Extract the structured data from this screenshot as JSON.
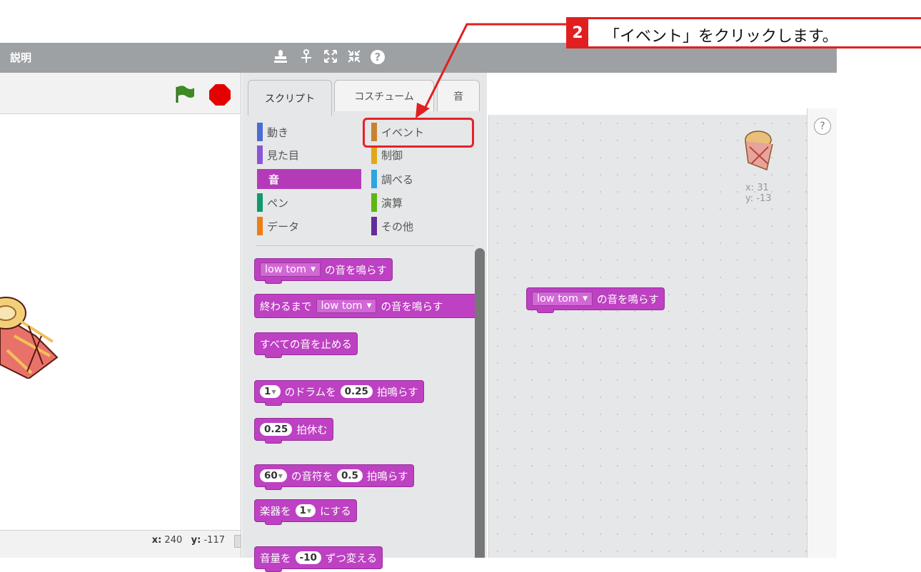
{
  "header": {
    "title": "説明",
    "tool_icons": [
      "stamp-icon",
      "scissors-icon",
      "grow-icon",
      "shrink-icon",
      "help-icon"
    ]
  },
  "stage": {
    "coord_x_label": "x:",
    "coord_x": "240",
    "coord_y_label": "y:",
    "coord_y": "-117"
  },
  "tabs": {
    "scripts": "スクリプト",
    "costumes": "コスチューム",
    "sounds": "音"
  },
  "categories": {
    "motion": "動き",
    "events": "イベント",
    "looks": "見た目",
    "control": "制御",
    "sound": "音",
    "sensing": "調べる",
    "pen": "ペン",
    "operators": "演算",
    "data": "データ",
    "more": "その他"
  },
  "category_colors": {
    "motion": "#4a6cd4",
    "events": "#c88330",
    "looks": "#8a55d7",
    "control": "#e1a91a",
    "sound": "#bb42c3",
    "sensing": "#2ca5e2",
    "pen": "#0e9a6c",
    "operators": "#5cb712",
    "data": "#ee7d16",
    "more": "#632d99"
  },
  "palette_blocks": {
    "play_sound": {
      "dropdown": "low tom",
      "text": "の音を鳴らす"
    },
    "play_until_done": {
      "prefix": "終わるまで",
      "dropdown": "low tom",
      "text": "の音を鳴らす"
    },
    "stop_all": {
      "text": "すべての音を止める"
    },
    "play_drum": {
      "num1": "1",
      "text1": "のドラムを",
      "num2": "0.25",
      "text2": "拍鳴らす"
    },
    "rest": {
      "num": "0.25",
      "text": "拍休む"
    },
    "play_note": {
      "num1": "60",
      "text1": "の音符を",
      "num2": "0.5",
      "text2": "拍鳴らす"
    },
    "set_instrument": {
      "prefix": "楽器を",
      "num": "1",
      "text": "にする"
    },
    "change_volume": {
      "prefix": "音量を",
      "num": "-10",
      "text": "ずつ変える"
    }
  },
  "script_block": {
    "dropdown": "low tom",
    "text": "の音を鳴らす"
  },
  "sprite_info": {
    "x": "x: 31",
    "y": "y: -13"
  },
  "callout": {
    "number": "2",
    "text": "「イベント」をクリックします。"
  },
  "colors": {
    "accent_red": "#e02020",
    "sound_block": "#bd41c2"
  }
}
